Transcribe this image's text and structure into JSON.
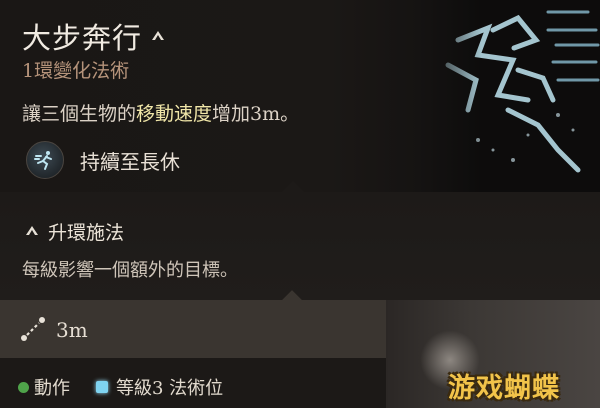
{
  "spell": {
    "title": "大步奔行",
    "subtitle": "1環變化法術",
    "description_prefix": "讓三個生物的",
    "description_highlight": "移動速度",
    "description_suffix": "增加3m。",
    "duration_label": "持續至長休"
  },
  "upcast": {
    "heading": "升環施法",
    "description": "每級影響一個額外的目標。"
  },
  "range": {
    "value": "3m"
  },
  "footer": {
    "action_label": "動作",
    "slot_label": "等級3 法術位"
  },
  "watermark": "游戏蝴蝶",
  "colors": {
    "action_dot": "#4fa34a",
    "slot_square": "#7fd3f0",
    "highlight_text": "#f0e6a8",
    "subtitle": "#b5937a",
    "watermark": "#f2c44a"
  },
  "icons": {
    "upcast": "upcast-chevron-icon",
    "duration": "running-figure-icon",
    "range": "range-dashed-line-icon",
    "art": "spell-art-icon"
  }
}
